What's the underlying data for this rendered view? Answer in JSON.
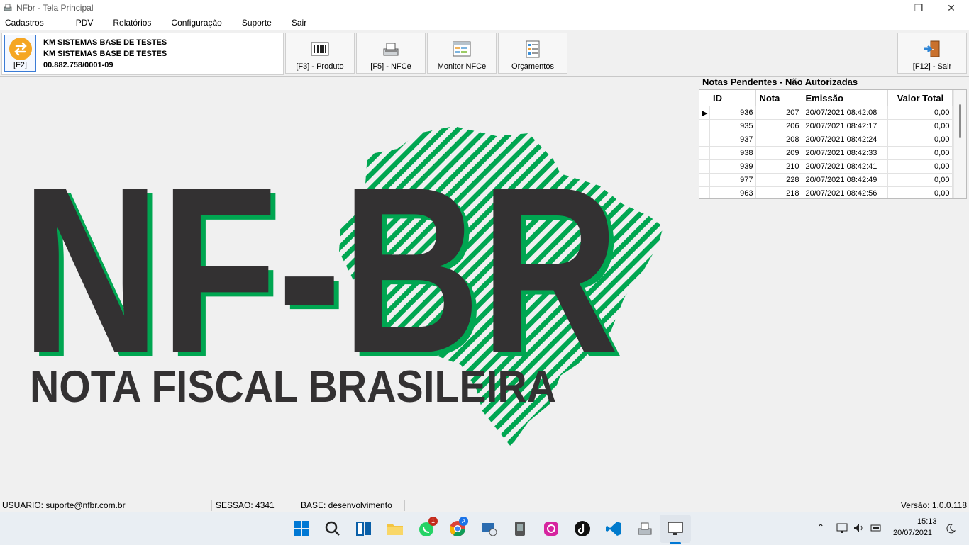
{
  "window": {
    "title": "NFbr - Tela Principal",
    "controls": {
      "minimize": "—",
      "maximize": "❐",
      "close": "✕"
    }
  },
  "menu": [
    "Cadastros",
    "PDV",
    "Relatórios",
    "Configuração",
    "Suporte",
    "Sair"
  ],
  "company": {
    "f2_label": "[F2]",
    "name1": "KM SISTEMAS BASE DE TESTES",
    "name2": "KM SISTEMAS BASE DE TESTES",
    "cnpj": "00.882.758/0001-09"
  },
  "toolbar": {
    "produto": "[F3] - Produto",
    "nfce": "[F5] - NFCe",
    "monitor": "Monitor NFCe",
    "orcamentos": "Orçamentos",
    "sair": "[F12] - Sair"
  },
  "pending": {
    "title": "Notas Pendentes - Não Autorizadas",
    "columns": [
      "ID",
      "Nota",
      "Emissão",
      "Valor Total"
    ],
    "rows": [
      [
        "936",
        "207",
        "20/07/2021 08:42:08",
        "0,00"
      ],
      [
        "935",
        "206",
        "20/07/2021 08:42:17",
        "0,00"
      ],
      [
        "937",
        "208",
        "20/07/2021 08:42:24",
        "0,00"
      ],
      [
        "938",
        "209",
        "20/07/2021 08:42:33",
        "0,00"
      ],
      [
        "939",
        "210",
        "20/07/2021 08:42:41",
        "0,00"
      ],
      [
        "977",
        "228",
        "20/07/2021 08:42:49",
        "0,00"
      ],
      [
        "963",
        "218",
        "20/07/2021 08:42:56",
        "0,00"
      ]
    ]
  },
  "logo": {
    "text1": "NF-BR",
    "text2": "NOTA FISCAL BRASILEIRA",
    "colors": {
      "dark": "#333132",
      "green": "#00a651"
    }
  },
  "status": {
    "usuario": "USUARIO: suporte@nfbr.com.br",
    "sessao": "SESSAO: 4341",
    "base": "BASE: desenvolvimento",
    "versao": "Versão: 1.0.0.118"
  },
  "taskbar": {
    "whatsapp_badge": "1",
    "chrome_badge": "A",
    "time": "15:13",
    "date": "20/07/2021"
  },
  "colors": {
    "accent": "#0078d4",
    "f2_circle": "#f5a623"
  }
}
